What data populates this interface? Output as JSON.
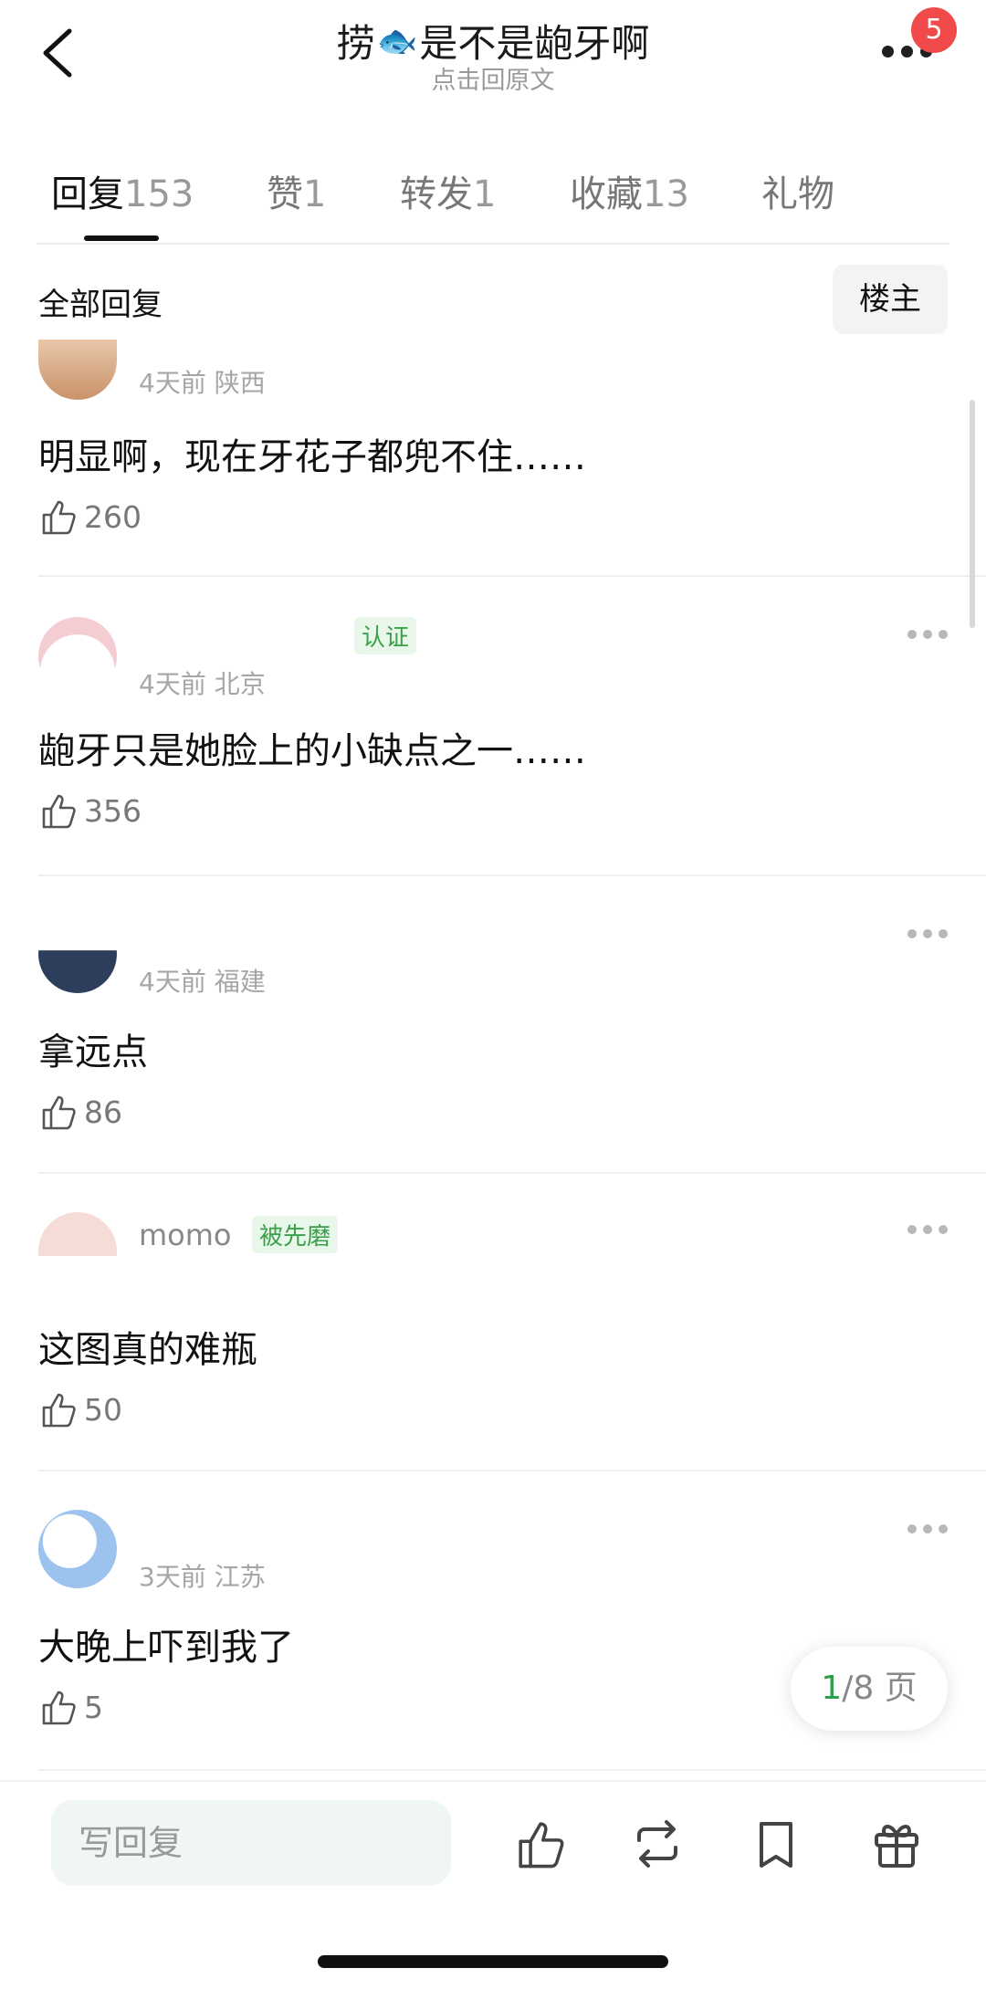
{
  "header": {
    "title_prefix": "捞",
    "title_emoji": "🐟",
    "title_suffix": "是不是龅牙啊",
    "subtitle": "点击回原文",
    "notification_count": "5"
  },
  "tabs": [
    {
      "label": "回复",
      "count": "153",
      "active": true
    },
    {
      "label": "赞",
      "count": "1"
    },
    {
      "label": "转发",
      "count": "1"
    },
    {
      "label": "收藏",
      "count": "13"
    },
    {
      "label": "礼物",
      "count": ""
    }
  ],
  "section": {
    "label": "全部回复",
    "owner_button": "楼主"
  },
  "comments": [
    {
      "name": "",
      "tag": "",
      "meta": "4天前 陕西",
      "text": "明显啊，现在牙花子都兜不住……",
      "likes": "260"
    },
    {
      "name": "",
      "tag": "认证",
      "meta": "4天前 北京",
      "text": "龅牙只是她脸上的小缺点之一……",
      "likes": "356"
    },
    {
      "name": "",
      "tag": "",
      "meta": "4天前 福建",
      "text": "拿远点",
      "likes": "86"
    },
    {
      "name": "momo",
      "tag": "被先磨",
      "meta": "",
      "text": "这图真的难瓶",
      "likes": "50"
    },
    {
      "name": "",
      "tag": "",
      "meta": "3天前 江苏",
      "text": "大晚上吓到我了",
      "likes": "5"
    }
  ],
  "pager": {
    "current": "1",
    "total": "/8 页"
  },
  "bottom_bar": {
    "reply_placeholder": "写回复"
  },
  "colors": {
    "accent_green": "#2f9f4a",
    "badge_red": "#f04a4a"
  },
  "icons": [
    "back-icon",
    "more-icon",
    "like-icon",
    "repost-icon",
    "bookmark-icon",
    "gift-icon"
  ]
}
